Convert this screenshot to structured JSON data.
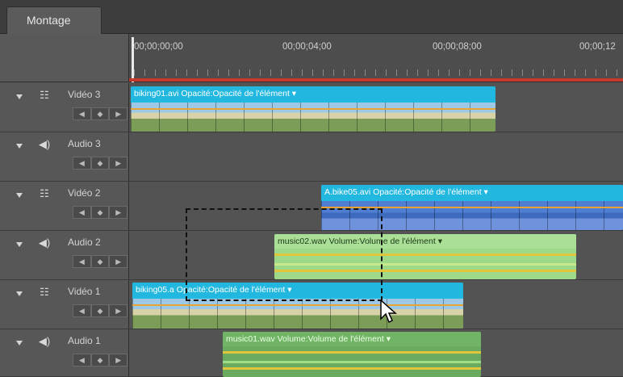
{
  "tab": {
    "label": "Montage"
  },
  "ruler": {
    "timecodes": [
      "00;00;00;00",
      "00;00;04;00",
      "00;00;08;00",
      "00;00;12"
    ]
  },
  "tracks": [
    {
      "name": "Vidéo 3",
      "kind": "video"
    },
    {
      "name": "Audio 3",
      "kind": "audio"
    },
    {
      "name": "Vidéo 2",
      "kind": "video"
    },
    {
      "name": "Audio 2",
      "kind": "audio"
    },
    {
      "name": "Vidéo 1",
      "kind": "video"
    },
    {
      "name": "Audio 1",
      "kind": "audio"
    }
  ],
  "keyframe_nav": {
    "prev": "◀",
    "add": "◆",
    "next": "▶"
  },
  "clips": {
    "v3": {
      "label": "biking01.avi  Opacité:Opacité de l'élément ▾"
    },
    "v2": {
      "label": "A.bike05.avi  Opacité:Opacité de l'élément ▾"
    },
    "a2": {
      "label": "music02.wav Volume:Volume de l'élément ▾"
    },
    "v1": {
      "label": "biking05.a     Opacité:Opacité de l'élément ▾"
    },
    "a1": {
      "label": "music01.wav Volume:Volume de l'élément ▾"
    }
  },
  "icons": {
    "video_track": "film-track-icon",
    "audio_track": "speaker-icon",
    "collapse": "triangle-down-icon",
    "pointer": "arrow-cursor-icon"
  }
}
